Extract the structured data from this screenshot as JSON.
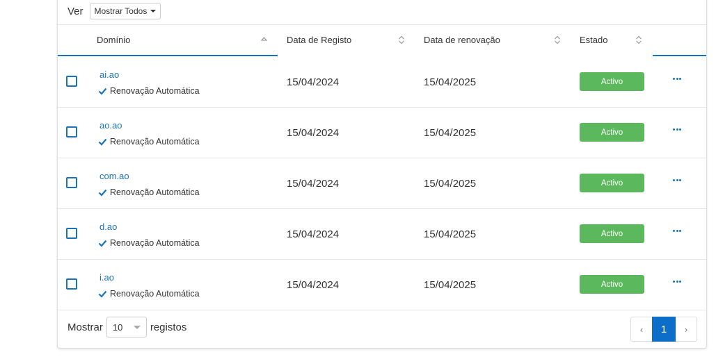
{
  "toolbar": {
    "view_label": "Ver",
    "view_option": "Mostrar Todos"
  },
  "table": {
    "columns": [
      {
        "label": "Domínio"
      },
      {
        "label": "Data de Registo"
      },
      {
        "label": "Data de renovação"
      },
      {
        "label": "Estado"
      }
    ],
    "rows": [
      {
        "domain": "ai.ao",
        "autorenew": "Renovação Automática",
        "registered": "15/04/2024",
        "renewal": "15/04/2025",
        "status": "Activo"
      },
      {
        "domain": "ao.ao",
        "autorenew": "Renovação Automática",
        "registered": "15/04/2024",
        "renewal": "15/04/2025",
        "status": "Activo"
      },
      {
        "domain": "com.ao",
        "autorenew": "Renovação Automática",
        "registered": "15/04/2024",
        "renewal": "15/04/2025",
        "status": "Activo"
      },
      {
        "domain": "d.ao",
        "autorenew": "Renovação Automática",
        "registered": "15/04/2024",
        "renewal": "15/04/2025",
        "status": "Activo"
      },
      {
        "domain": "i.ao",
        "autorenew": "Renovação Automática",
        "registered": "15/04/2024",
        "renewal": "15/04/2025",
        "status": "Activo"
      }
    ],
    "actions_icon": "ellipsis-icon",
    "status_color": "#5cb85c",
    "link_color": "#1a73b8"
  },
  "footer": {
    "show_label": "Mostrar",
    "page_size": "10",
    "records_label": "registos",
    "pagination": {
      "prev": "‹",
      "current": "1",
      "next": "›"
    },
    "active_color": "#0d6ec9"
  }
}
